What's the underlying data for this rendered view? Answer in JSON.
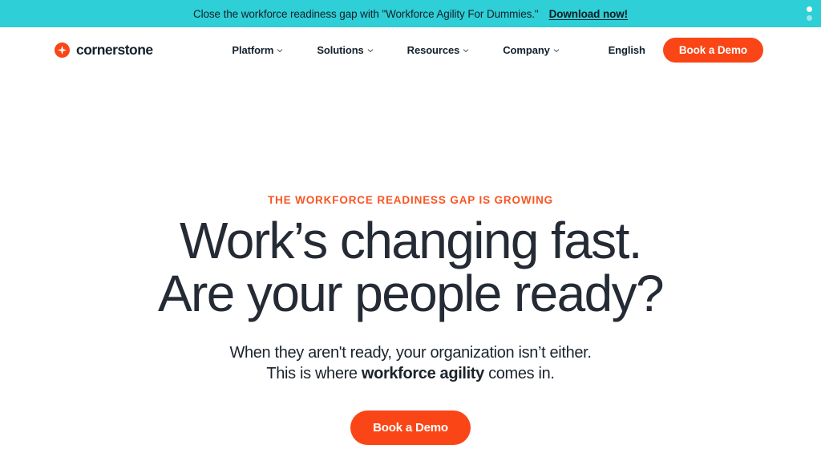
{
  "colors": {
    "banner_bg": "#2ecfd6",
    "accent_orange": "#fa4616",
    "eyebrow_orange": "#fa5423",
    "heading_navy": "#242b35",
    "page_bg": "#ffffff"
  },
  "promo_banner": {
    "text": "Close the workforce readiness gap with \"Workforce Agility For Dummies.\"",
    "link_label": "Download now!",
    "menu_icon": "vertical-dots-icon"
  },
  "header": {
    "brand": {
      "name": "cornerstone",
      "logo_icon": "cornerstone-star-logo-icon"
    },
    "nav": [
      {
        "label": "Platform",
        "icon": "chevron-down-icon"
      },
      {
        "label": "Solutions",
        "icon": "chevron-down-icon"
      },
      {
        "label": "Resources",
        "icon": "chevron-down-icon"
      },
      {
        "label": "Company",
        "icon": "chevron-down-icon"
      }
    ],
    "language": "English",
    "cta_label": "Book a Demo"
  },
  "hero": {
    "eyebrow": "THE WORKFORCE READINESS GAP IS GROWING",
    "title_line1": "Work’s changing fast.",
    "title_line2": "Are your people ready?",
    "sub_line1": "When they aren't ready, your organization isn’t either.",
    "sub_line2_before": "This is where ",
    "sub_line2_strong": "workforce agility",
    "sub_line2_after": " comes in.",
    "cta_label": "Book a Demo"
  }
}
